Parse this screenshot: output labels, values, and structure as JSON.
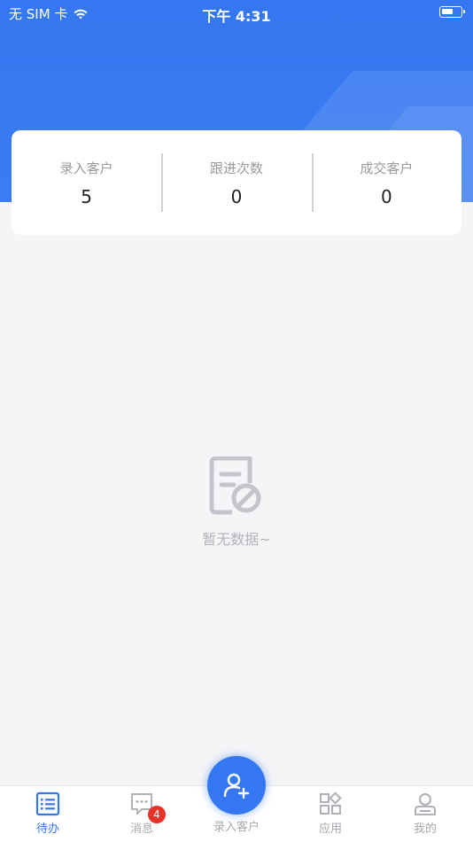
{
  "status_bar": {
    "carrier": "无 SIM 卡",
    "time": "下午 4:31"
  },
  "stats": [
    {
      "label": "录入客户",
      "value": "5"
    },
    {
      "label": "跟进次数",
      "value": "0"
    },
    {
      "label": "成交客户",
      "value": "0"
    }
  ],
  "empty_state": {
    "text": "暂无数据~",
    "icon": "no-data-document-icon"
  },
  "tabbar": {
    "items": [
      {
        "label": "待办",
        "icon": "todo-list-icon",
        "active": true
      },
      {
        "label": "消息",
        "icon": "message-icon",
        "badge": "4"
      },
      {
        "label": "录入客户",
        "icon": "add-user-icon"
      },
      {
        "label": "应用",
        "icon": "apps-grid-icon"
      },
      {
        "label": "我的",
        "icon": "profile-icon"
      }
    ]
  },
  "colors": {
    "primary": "#3477f0",
    "badge": "#e8332b",
    "background": "#f5f5f7"
  }
}
